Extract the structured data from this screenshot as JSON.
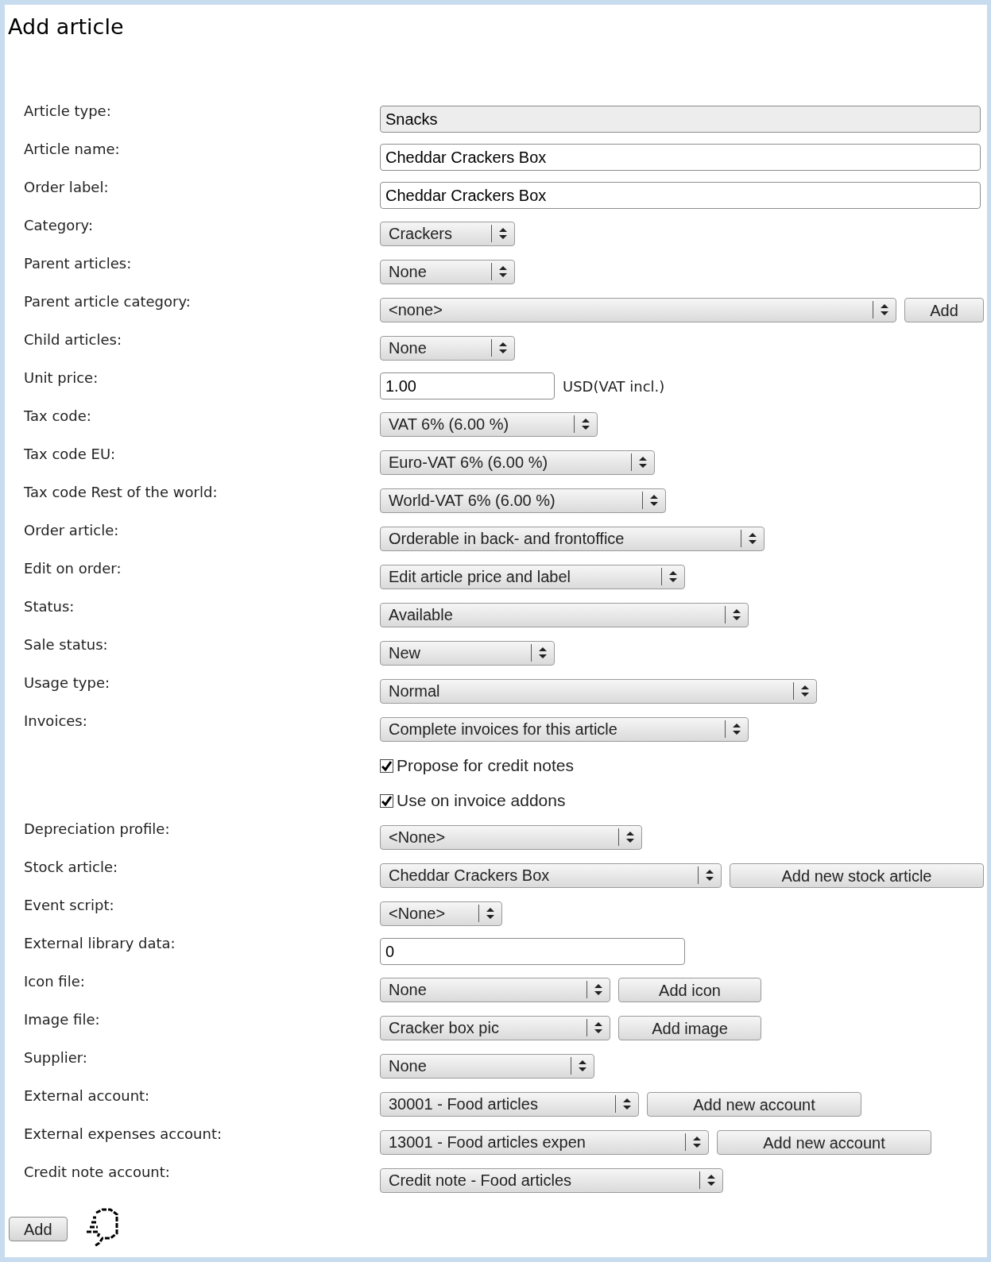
{
  "title": "Add article",
  "fields": [
    {
      "label": "Article type:",
      "controls": [
        {
          "kind": "readonly",
          "value": "Snacks"
        }
      ]
    },
    {
      "label": "Article name:",
      "controls": [
        {
          "kind": "text",
          "value": "Cheddar Crackers Box"
        }
      ]
    },
    {
      "label": "Order label:",
      "controls": [
        {
          "kind": "text",
          "value": "Cheddar Crackers Box"
        }
      ]
    },
    {
      "label": "Category:",
      "controls": [
        {
          "kind": "select",
          "value": "Crackers"
        }
      ]
    },
    {
      "label": "Parent articles:",
      "controls": [
        {
          "kind": "select",
          "value": "None"
        }
      ]
    },
    {
      "label": "Parent article category:",
      "controls": [
        {
          "kind": "select",
          "value": "<none>"
        },
        {
          "kind": "button",
          "value": "Add"
        }
      ]
    },
    {
      "label": "Child articles:",
      "controls": [
        {
          "kind": "select",
          "value": "None"
        }
      ]
    },
    {
      "label": "Unit price:",
      "controls": [
        {
          "kind": "text",
          "value": "1.00"
        },
        {
          "kind": "suffix",
          "value": "USD(VAT incl.)"
        }
      ]
    },
    {
      "label": "Tax code:",
      "controls": [
        {
          "kind": "select",
          "value": "VAT 6% (6.00 %)"
        }
      ]
    },
    {
      "label": "Tax code EU:",
      "controls": [
        {
          "kind": "select",
          "value": "Euro-VAT 6% (6.00 %)"
        }
      ]
    },
    {
      "label": "Tax code Rest of the world:",
      "controls": [
        {
          "kind": "select",
          "value": "World-VAT 6% (6.00 %)"
        }
      ]
    },
    {
      "label": "Order article:",
      "controls": [
        {
          "kind": "select",
          "value": "Orderable in back- and frontoffice"
        }
      ]
    },
    {
      "label": "Edit on order:",
      "controls": [
        {
          "kind": "select",
          "value": "Edit article price and label"
        }
      ]
    },
    {
      "label": "Status:",
      "controls": [
        {
          "kind": "select",
          "value": "Available"
        }
      ]
    },
    {
      "label": "Sale status:",
      "controls": [
        {
          "kind": "select",
          "value": "New"
        }
      ]
    },
    {
      "label": "Usage type:",
      "controls": [
        {
          "kind": "select",
          "value": "Normal"
        }
      ]
    },
    {
      "label": "Invoices:",
      "controls": [
        {
          "kind": "select",
          "value": "Complete invoices for this article"
        }
      ]
    },
    {
      "controls": [
        {
          "kind": "checkbox",
          "value": "Propose for credit notes",
          "checked": true
        }
      ]
    },
    {
      "controls": [
        {
          "kind": "checkbox",
          "value": "Use on invoice addons",
          "checked": true
        }
      ]
    },
    {
      "label": "Depreciation profile:",
      "controls": [
        {
          "kind": "select",
          "value": "<None>"
        }
      ]
    },
    {
      "label": "Stock article:",
      "controls": [
        {
          "kind": "select",
          "value": "Cheddar Crackers Box"
        },
        {
          "kind": "button",
          "value": "Add new stock article"
        }
      ]
    },
    {
      "label": "Event script:",
      "controls": [
        {
          "kind": "select",
          "value": "<None>"
        }
      ]
    },
    {
      "label": "External library data:",
      "controls": [
        {
          "kind": "text",
          "value": "0"
        }
      ]
    },
    {
      "label": "Icon file:",
      "controls": [
        {
          "kind": "select",
          "value": "None"
        },
        {
          "kind": "button",
          "value": "Add icon"
        }
      ]
    },
    {
      "label": "Image file:",
      "controls": [
        {
          "kind": "select",
          "value": "Cracker box pic"
        },
        {
          "kind": "button",
          "value": "Add image"
        }
      ]
    },
    {
      "label": "Supplier:",
      "controls": [
        {
          "kind": "select",
          "value": "None"
        }
      ]
    },
    {
      "label": "External account:",
      "controls": [
        {
          "kind": "select",
          "value": "30001 - Food articles"
        },
        {
          "kind": "button",
          "value": "Add new account"
        }
      ]
    },
    {
      "label": "External expenses account:",
      "controls": [
        {
          "kind": "select",
          "value": "13001 - Food articles expen"
        },
        {
          "kind": "button",
          "value": "Add new account"
        }
      ]
    },
    {
      "label": "Credit note account:",
      "controls": [
        {
          "kind": "select",
          "value": "Credit note - Food articles"
        }
      ]
    }
  ],
  "submit": "Add"
}
